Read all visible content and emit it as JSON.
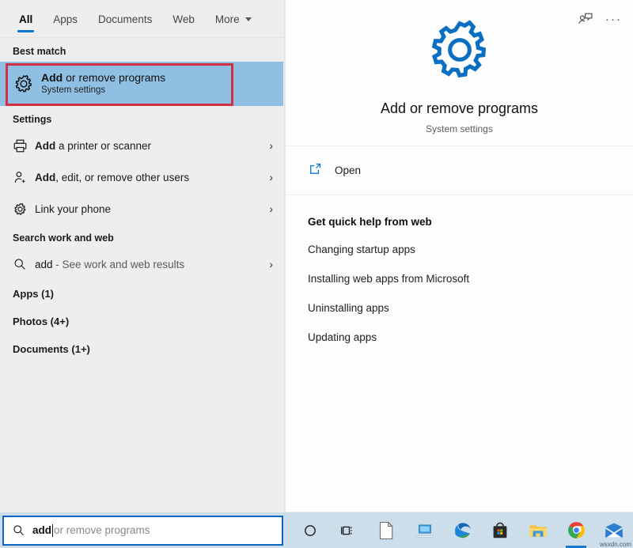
{
  "tabs": [
    {
      "label": "All",
      "active": true
    },
    {
      "label": "Apps",
      "active": false
    },
    {
      "label": "Documents",
      "active": false
    },
    {
      "label": "Web",
      "active": false
    },
    {
      "label": "More",
      "active": false,
      "caret": true
    }
  ],
  "top_right": {
    "feedback_icon": "feedback-person-icon",
    "more_label": "···"
  },
  "left": {
    "best_match_heading": "Best match",
    "best_match": {
      "title_bold": "Add",
      "title_rest": " or remove programs",
      "subtitle": "System settings",
      "icon": "gear-icon",
      "highlight_color": "#cf3042",
      "selection_color": "#8fc0e3"
    },
    "settings_heading": "Settings",
    "settings_items": [
      {
        "bold": "Add",
        "rest": " a printer or scanner",
        "icon": "printer-icon"
      },
      {
        "bold": "Add",
        "rest": ", edit, or remove other users",
        "icon": "add-user-icon"
      },
      {
        "bold": "",
        "rest": "Link your phone",
        "icon": "gear-icon"
      }
    ],
    "web_heading": "Search work and web",
    "web_item": {
      "query": "add",
      "rest": " - See work and web results",
      "icon": "search-icon"
    },
    "categories": [
      {
        "label": "Apps (1)"
      },
      {
        "label": "Photos (4+)"
      },
      {
        "label": "Documents (1+)"
      }
    ]
  },
  "preview": {
    "icon": "gear-icon",
    "title": "Add or remove programs",
    "subtitle": "System settings",
    "open_label": "Open",
    "open_icon": "open-external-icon",
    "help_title": "Get quick help from web",
    "help_links": [
      "Changing startup apps",
      "Installing web apps from Microsoft",
      "Uninstalling apps",
      "Updating apps"
    ]
  },
  "taskbar": {
    "search": {
      "icon": "search-icon",
      "typed_value": "add",
      "suggestion_suffix": "or remove programs"
    },
    "icons": [
      {
        "name": "cortana-icon",
        "active": false
      },
      {
        "name": "task-view-icon",
        "active": false
      },
      {
        "name": "document-icon",
        "active": false
      },
      {
        "name": "remote-desktop-icon",
        "active": false
      },
      {
        "name": "edge-icon",
        "active": false
      },
      {
        "name": "microsoft-store-icon",
        "active": false
      },
      {
        "name": "file-explorer-icon",
        "active": false
      },
      {
        "name": "chrome-icon",
        "active": true
      },
      {
        "name": "mail-icon",
        "active": false
      }
    ],
    "watermark": "wsxdn.com"
  },
  "colors": {
    "accent": "#0a78d4",
    "selection": "#8fc0e3",
    "highlight": "#cf3042",
    "taskbar": "#cddeeb"
  }
}
